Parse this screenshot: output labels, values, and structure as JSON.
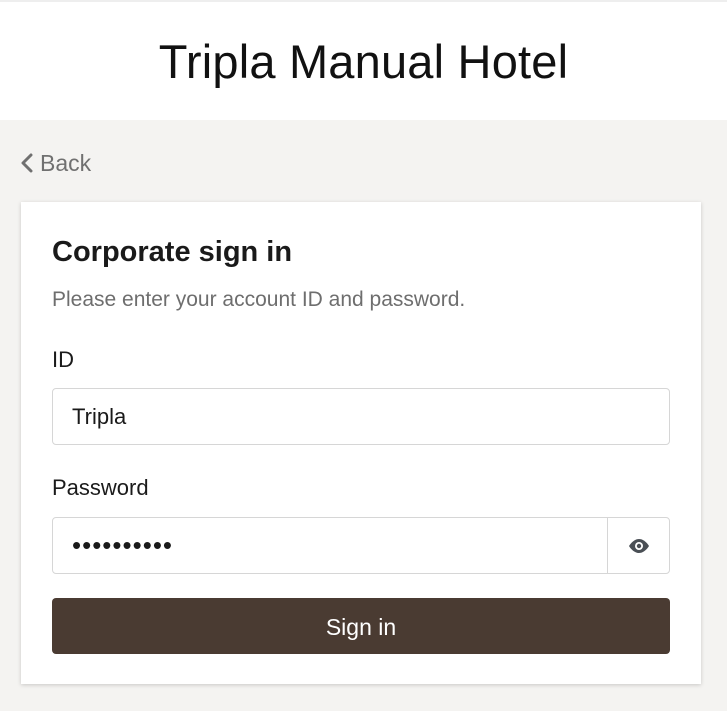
{
  "header": {
    "title": "Tripla Manual Hotel"
  },
  "nav": {
    "back_label": "Back"
  },
  "signin": {
    "title": "Corporate sign in",
    "subtitle": "Please enter your account ID and password.",
    "id_label": "ID",
    "id_value": "Tripla",
    "password_label": "Password",
    "password_value": "••••••••••",
    "submit_label": "Sign in"
  },
  "colors": {
    "page_background": "#f4f3f1",
    "button_background": "#4a3b32",
    "muted_text": "#6e6e6e"
  },
  "icons": {
    "back": "chevron-left-icon",
    "password_toggle": "eye-icon"
  }
}
